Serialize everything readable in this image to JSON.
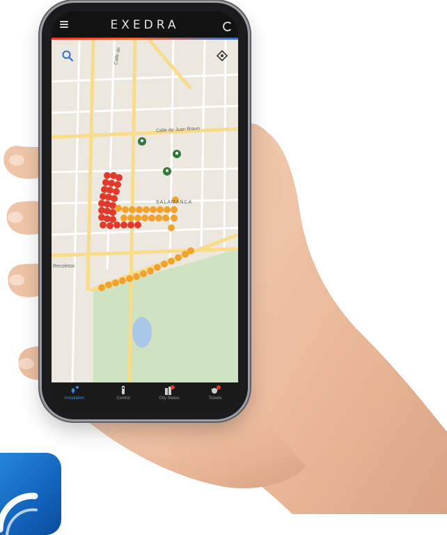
{
  "app": {
    "logo_text": "EXEDRA",
    "accent_colors": [
      "#e63a2e",
      "#3b73c8"
    ]
  },
  "map": {
    "street_label": "Calle de Juan Bravo",
    "district_label": "SALAMANCA",
    "side_street_label": "Calle de",
    "left_label": "Recoletos",
    "colors": {
      "green_marker": "#2f7a3a",
      "red_marker": "#e2392b",
      "orange_marker": "#f2a22c",
      "park": "#cfe3c2"
    }
  },
  "nav": {
    "items": [
      {
        "label": "Installation",
        "icon": "installation-icon",
        "active": true
      },
      {
        "label": "Control",
        "icon": "control-icon",
        "active": false
      },
      {
        "label": "City Status",
        "icon": "city-status-icon",
        "active": false
      },
      {
        "label": "Tickets",
        "icon": "tickets-icon",
        "active": false
      }
    ],
    "active_color": "#3b8be6"
  }
}
